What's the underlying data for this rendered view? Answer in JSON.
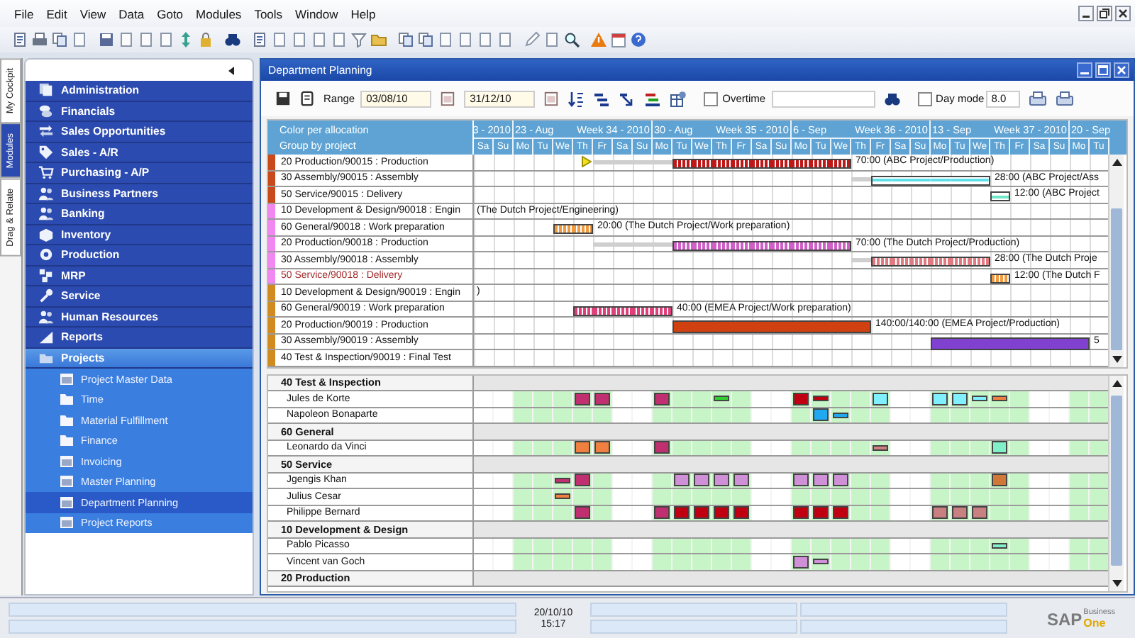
{
  "menu": [
    "File",
    "Edit",
    "View",
    "Data",
    "Goto",
    "Modules",
    "Tools",
    "Window",
    "Help"
  ],
  "side_tabs": [
    {
      "label": "My Cockpit",
      "selected": false
    },
    {
      "label": "Modules",
      "selected": true
    },
    {
      "label": "Drag & Relate",
      "selected": false
    }
  ],
  "modules": [
    {
      "label": "Administration",
      "expanded": false
    },
    {
      "label": "Financials",
      "expanded": false
    },
    {
      "label": "Sales Opportunities",
      "expanded": false
    },
    {
      "label": "Sales - A/R",
      "expanded": false
    },
    {
      "label": "Purchasing - A/P",
      "expanded": false
    },
    {
      "label": "Business Partners",
      "expanded": false
    },
    {
      "label": "Banking",
      "expanded": false
    },
    {
      "label": "Inventory",
      "expanded": false
    },
    {
      "label": "Production",
      "expanded": false
    },
    {
      "label": "MRP",
      "expanded": false
    },
    {
      "label": "Service",
      "expanded": false
    },
    {
      "label": "Human Resources",
      "expanded": false
    },
    {
      "label": "Reports",
      "expanded": false
    },
    {
      "label": "Projects",
      "expanded": true,
      "children": [
        {
          "label": "Project Master Data",
          "kind": "form",
          "selected": false
        },
        {
          "label": "Time",
          "kind": "folder",
          "selected": false
        },
        {
          "label": "Material Fulfillment",
          "kind": "folder",
          "selected": false
        },
        {
          "label": "Finance",
          "kind": "folder",
          "selected": false
        },
        {
          "label": "Invoicing",
          "kind": "form",
          "selected": false
        },
        {
          "label": "Master Planning",
          "kind": "form",
          "selected": false
        },
        {
          "label": "Department Planning",
          "kind": "form",
          "selected": true
        },
        {
          "label": "Project Reports",
          "kind": "form",
          "selected": false
        }
      ]
    }
  ],
  "planning": {
    "title": "Department Planning",
    "range_label": "Range",
    "range_from": "03/08/10",
    "range_to": "31/12/10",
    "overtime": {
      "label": "Overtime",
      "checked": false
    },
    "day_mode": {
      "label": "Day mode",
      "checked": false,
      "value": "8.0"
    },
    "header_labels": [
      "Color per allocation",
      "Group by project"
    ],
    "timeline": {
      "weeks": [
        {
          "week": "3 - 2010",
          "days": [
            {
              "label": "Sa",
              "weekend": true
            },
            {
              "label": "Su",
              "weekend": true
            }
          ]
        },
        {
          "date": "23 - Aug",
          "week": "Week 34 - 2010",
          "days": [
            {
              "label": "Mo",
              "weekend": false
            },
            {
              "label": "Tu",
              "weekend": false
            },
            {
              "label": "We",
              "weekend": false
            },
            {
              "label": "Th",
              "weekend": false
            },
            {
              "label": "Fr",
              "weekend": false
            },
            {
              "label": "Sa",
              "weekend": true
            },
            {
              "label": "Su",
              "weekend": true
            }
          ]
        },
        {
          "date": "30 - Aug",
          "week": "Week 35 - 2010",
          "days": [
            {
              "label": "Mo",
              "weekend": false
            },
            {
              "label": "Tu",
              "weekend": false
            },
            {
              "label": "We",
              "weekend": false
            },
            {
              "label": "Th",
              "weekend": false
            },
            {
              "label": "Fr",
              "weekend": false
            },
            {
              "label": "Sa",
              "weekend": true
            },
            {
              "label": "Su",
              "weekend": true
            }
          ]
        },
        {
          "date": "6 - Sep",
          "week": "Week 36 - 2010",
          "days": [
            {
              "label": "Mo",
              "weekend": false
            },
            {
              "label": "Tu",
              "weekend": false
            },
            {
              "label": "We",
              "weekend": false
            },
            {
              "label": "Th",
              "weekend": false
            },
            {
              "label": "Fr",
              "weekend": false
            },
            {
              "label": "Sa",
              "weekend": true
            },
            {
              "label": "Su",
              "weekend": true
            }
          ]
        },
        {
          "date": "13 - Sep",
          "week": "Week 37 - 2010",
          "days": [
            {
              "label": "Mo",
              "weekend": false
            },
            {
              "label": "Tu",
              "weekend": false
            },
            {
              "label": "We",
              "weekend": false
            },
            {
              "label": "Th",
              "weekend": false
            },
            {
              "label": "Fr",
              "weekend": false
            },
            {
              "label": "Sa",
              "weekend": true
            },
            {
              "label": "Su",
              "weekend": true
            }
          ]
        },
        {
          "date": "20 - Sep",
          "days": [
            {
              "label": "Mo",
              "weekend": false
            },
            {
              "label": "Tu",
              "weekend": false
            }
          ]
        }
      ]
    },
    "rows": [
      {
        "label": "20 Production/90015 : Production",
        "color": "#c84a1a",
        "highlighted": false,
        "text": "70:00 (ABC Project/Production)",
        "cells": [
          null,
          null,
          null,
          null,
          null,
          {
            "kind": "milestone"
          },
          {
            "kind": "lead"
          },
          {
            "kind": "lead"
          },
          {
            "kind": "lead"
          },
          {
            "kind": "lead"
          },
          {
            "kind": "hatched",
            "color": "#c01818"
          },
          {
            "kind": "hatched",
            "color": "#c01818"
          },
          {
            "kind": "hatched",
            "color": "#c01818"
          },
          {
            "kind": "hatched",
            "color": "#c01818"
          },
          {
            "kind": "hatched",
            "color": "#c01818"
          },
          {
            "kind": "hatched",
            "color": "#c01818"
          },
          {
            "kind": "hatched",
            "color": "#c01818"
          },
          {
            "kind": "hatched",
            "color": "#c01818"
          },
          {
            "kind": "hatched",
            "color": "#c01818"
          }
        ]
      },
      {
        "label": "30 Assembly/90015 : Assembly",
        "color": "#c84a1a",
        "highlighted": false,
        "text": "28:00 (ABC Project/Ass",
        "cells": [
          null,
          null,
          null,
          null,
          null,
          null,
          null,
          null,
          null,
          null,
          null,
          null,
          null,
          null,
          null,
          null,
          null,
          null,
          null,
          {
            "kind": "lead"
          },
          {
            "kind": "outline",
            "color": "#60e0e8"
          },
          {
            "kind": "outline",
            "color": "#60e0e8"
          },
          {
            "kind": "outline",
            "color": "#60e0e8"
          },
          {
            "kind": "outline",
            "color": "#60e0e8"
          },
          {
            "kind": "outline",
            "color": "#60e0e8"
          },
          {
            "kind": "outline",
            "color": "#60e0e8"
          }
        ]
      },
      {
        "label": "50 Service/90015 : Delivery",
        "color": "#c84a1a",
        "highlighted": false,
        "text": "12:00 (ABC Project",
        "cells": [
          null,
          null,
          null,
          null,
          null,
          null,
          null,
          null,
          null,
          null,
          null,
          null,
          null,
          null,
          null,
          null,
          null,
          null,
          null,
          null,
          null,
          null,
          null,
          null,
          null,
          null,
          {
            "kind": "outline",
            "color": "#70e8c8"
          }
        ]
      },
      {
        "label": "10 Development & Design/90018 : Engin",
        "color": "#f088f0",
        "highlighted": false,
        "text": "(The Dutch Project/Engineering)"
      },
      {
        "label": "60 General/90018 : Work preparation",
        "color": "#f088f0",
        "highlighted": false,
        "text": "20:00 (The Dutch Project/Work preparation)",
        "cells": [
          null,
          null,
          null,
          null,
          {
            "kind": "hatched",
            "color": "#f09a40"
          },
          {
            "kind": "hatched",
            "color": "#f09a40"
          }
        ]
      },
      {
        "label": "20 Production/90018 : Production",
        "color": "#f088f0",
        "highlighted": false,
        "text": "70:00 (The Dutch Project/Production)",
        "cells": [
          null,
          null,
          null,
          null,
          null,
          null,
          {
            "kind": "lead"
          },
          {
            "kind": "lead"
          },
          {
            "kind": "lead"
          },
          {
            "kind": "lead"
          },
          {
            "kind": "hatched",
            "color": "#d060c8"
          },
          {
            "kind": "hatched",
            "color": "#d060c8"
          },
          {
            "kind": "hatched",
            "color": "#d060c8"
          },
          {
            "kind": "hatched",
            "color": "#d060c8"
          },
          {
            "kind": "hatched",
            "color": "#d060c8"
          },
          {
            "kind": "hatched",
            "color": "#d060c8"
          },
          {
            "kind": "hatched",
            "color": "#d060c8"
          },
          {
            "kind": "hatched",
            "color": "#d060c8"
          },
          {
            "kind": "hatched",
            "color": "#d060c8"
          }
        ]
      },
      {
        "label": "30 Assembly/90018 : Assembly",
        "color": "#f088f0",
        "highlighted": false,
        "text": "28:00 (The Dutch Proje",
        "cells": [
          null,
          null,
          null,
          null,
          null,
          null,
          null,
          null,
          null,
          null,
          null,
          null,
          null,
          null,
          null,
          null,
          null,
          null,
          null,
          {
            "kind": "lead"
          },
          {
            "kind": "hatched",
            "color": "#e07a80"
          },
          {
            "kind": "hatched",
            "color": "#e07a80"
          },
          {
            "kind": "hatched",
            "color": "#e07a80"
          },
          {
            "kind": "hatched",
            "color": "#e07a80"
          },
          {
            "kind": "hatched",
            "color": "#e07a80"
          },
          {
            "kind": "hatched",
            "color": "#e07a80"
          }
        ]
      },
      {
        "label": "50 Service/90018 : Delivery",
        "color": "#f088f0",
        "highlighted": true,
        "text": "12:00 (The Dutch F",
        "cells": [
          null,
          null,
          null,
          null,
          null,
          null,
          null,
          null,
          null,
          null,
          null,
          null,
          null,
          null,
          null,
          null,
          null,
          null,
          null,
          null,
          null,
          null,
          null,
          null,
          null,
          null,
          {
            "kind": "hatched",
            "color": "#f09a40"
          }
        ]
      },
      {
        "label": "10 Development & Design/90019 : Engin",
        "color": "#d08a20",
        "highlighted": false,
        "text": ")"
      },
      {
        "label": "60 General/90019 : Work preparation",
        "color": "#d08a20",
        "highlighted": false,
        "text": "40:00 (EMEA Project/Work preparation)",
        "cells": [
          null,
          null,
          null,
          null,
          null,
          {
            "kind": "hatched",
            "color": "#e0407a"
          },
          {
            "kind": "hatched",
            "color": "#e0407a"
          },
          {
            "kind": "hatched",
            "color": "#e0407a"
          },
          {
            "kind": "hatched",
            "color": "#e0407a"
          },
          {
            "kind": "hatched",
            "color": "#e0407a"
          }
        ]
      },
      {
        "label": "20 Production/90019 : Production",
        "color": "#d08a20",
        "highlighted": false,
        "text": "140:00/140:00 (EMEA Project/Production)",
        "cells": [
          null,
          null,
          null,
          null,
          null,
          null,
          null,
          null,
          null,
          null,
          {
            "kind": "solid",
            "color": "#d04010"
          },
          {
            "kind": "solid",
            "color": "#d04010"
          },
          {
            "kind": "solid",
            "color": "#d04010"
          },
          {
            "kind": "solid",
            "color": "#d04010"
          },
          {
            "kind": "solid",
            "color": "#d04010"
          },
          {
            "kind": "solid",
            "color": "#d04010"
          },
          {
            "kind": "solid",
            "color": "#d04010"
          },
          {
            "kind": "solid",
            "color": "#d04010"
          },
          {
            "kind": "solid",
            "color": "#d04010"
          },
          {
            "kind": "solid",
            "color": "#d04010"
          }
        ]
      },
      {
        "label": "30 Assembly/90019 : Assembly",
        "color": "#d08a20",
        "highlighted": false,
        "text": "5",
        "cells": [
          null,
          null,
          null,
          null,
          null,
          null,
          null,
          null,
          null,
          null,
          null,
          null,
          null,
          null,
          null,
          null,
          null,
          null,
          null,
          null,
          null,
          null,
          null,
          {
            "kind": "solid",
            "color": "#8040d0"
          },
          {
            "kind": "solid",
            "color": "#8040d0"
          },
          {
            "kind": "solid",
            "color": "#8040d0"
          },
          {
            "kind": "solid",
            "color": "#8040d0"
          },
          {
            "kind": "solid",
            "color": "#8040d0"
          },
          {
            "kind": "solid",
            "color": "#8040d0"
          },
          {
            "kind": "solid",
            "color": "#8040d0"
          },
          {
            "kind": "solid",
            "color": "#8040d0"
          }
        ]
      },
      {
        "label": "40 Test & Inspection/90019 : Final Test",
        "color": "#d08a20",
        "highlighted": false
      }
    ],
    "resources": [
      {
        "label": "40 Test & Inspection",
        "members": [
          {
            "name": "Jules de Korte",
            "cells": [
              null,
              null,
              null,
              null,
              null,
              {
                "color": "#c03070",
                "kind": "full"
              },
              {
                "color": "#c03070",
                "kind": "full"
              },
              null,
              null,
              {
                "color": "#c03070",
                "kind": "full"
              },
              null,
              null,
              {
                "color": "#30d030",
                "kind": "part"
              },
              null,
              null,
              null,
              {
                "color": "#c00010",
                "kind": "full"
              },
              {
                "color": "#c00010",
                "kind": "part"
              },
              null,
              null,
              {
                "color": "#80f0ff",
                "kind": "full"
              },
              null,
              null,
              {
                "color": "#80f0ff",
                "kind": "full"
              },
              {
                "color": "#80f0ff",
                "kind": "full"
              },
              {
                "color": "#80f0ff",
                "kind": "part"
              },
              {
                "color": "#f08040",
                "kind": "part"
              }
            ]
          },
          {
            "name": "Napoleon Bonaparte",
            "cells": [
              null,
              null,
              null,
              null,
              null,
              null,
              null,
              null,
              null,
              null,
              null,
              null,
              null,
              null,
              null,
              null,
              null,
              {
                "color": "#20a8f0",
                "kind": "full"
              },
              {
                "color": "#20a8f0",
                "kind": "part"
              }
            ]
          }
        ]
      },
      {
        "label": "60 General",
        "members": [
          {
            "name": "Leonardo da Vinci",
            "cells": [
              null,
              null,
              null,
              null,
              null,
              {
                "color": "#f08040",
                "kind": "full"
              },
              {
                "color": "#f08040",
                "kind": "full"
              },
              null,
              null,
              {
                "color": "#c03070",
                "kind": "full"
              },
              null,
              null,
              null,
              null,
              null,
              null,
              null,
              null,
              null,
              null,
              {
                "color": "#d08080",
                "kind": "part"
              },
              null,
              null,
              null,
              null,
              null,
              {
                "color": "#80f0c8",
                "kind": "full"
              }
            ]
          }
        ]
      },
      {
        "label": "50 Service",
        "members": [
          {
            "name": "Jgengis Khan",
            "cells": [
              null,
              null,
              null,
              null,
              {
                "color": "#c03070",
                "kind": "part"
              },
              {
                "color": "#c03070",
                "kind": "full"
              },
              null,
              null,
              null,
              null,
              {
                "color": "#d090d8",
                "kind": "full"
              },
              {
                "color": "#d090d8",
                "kind": "full"
              },
              {
                "color": "#d090d8",
                "kind": "full"
              },
              {
                "color": "#d090d8",
                "kind": "full"
              },
              null,
              null,
              {
                "color": "#d090d8",
                "kind": "full"
              },
              {
                "color": "#d090d8",
                "kind": "full"
              },
              {
                "color": "#d090d8",
                "kind": "full"
              },
              null,
              null,
              null,
              null,
              null,
              null,
              null,
              {
                "color": "#d07838",
                "kind": "full"
              }
            ]
          },
          {
            "name": "Julius Cesar",
            "cells": [
              null,
              null,
              null,
              null,
              {
                "color": "#f08040",
                "kind": "part"
              }
            ]
          },
          {
            "name": "Philippe Bernard",
            "cells": [
              null,
              null,
              null,
              null,
              null,
              {
                "color": "#c03070",
                "kind": "full"
              },
              null,
              null,
              null,
              {
                "color": "#c03070",
                "kind": "full"
              },
              {
                "color": "#c00010",
                "kind": "full"
              },
              {
                "color": "#c00010",
                "kind": "full"
              },
              {
                "color": "#c00010",
                "kind": "full"
              },
              {
                "color": "#c00010",
                "kind": "full"
              },
              null,
              null,
              {
                "color": "#c00010",
                "kind": "full"
              },
              {
                "color": "#c00010",
                "kind": "full"
              },
              {
                "color": "#c00010",
                "kind": "full"
              },
              null,
              null,
              null,
              null,
              {
                "color": "#c88080",
                "kind": "full"
              },
              {
                "color": "#c88080",
                "kind": "full"
              },
              {
                "color": "#c88080",
                "kind": "full"
              }
            ]
          }
        ]
      },
      {
        "label": "10 Development & Design",
        "members": [
          {
            "name": "Pablo Picasso",
            "cells": [
              null,
              null,
              null,
              null,
              null,
              null,
              null,
              null,
              null,
              null,
              null,
              null,
              null,
              null,
              null,
              null,
              null,
              null,
              null,
              null,
              null,
              null,
              null,
              null,
              null,
              null,
              {
                "color": "#80f0c8",
                "kind": "part"
              }
            ]
          },
          {
            "name": "Vincent van Goch",
            "cells": [
              null,
              null,
              null,
              null,
              null,
              null,
              null,
              null,
              null,
              null,
              null,
              null,
              null,
              null,
              null,
              null,
              {
                "color": "#d090d8",
                "kind": "full"
              },
              {
                "color": "#d090d8",
                "kind": "part"
              }
            ]
          }
        ]
      },
      {
        "label": "20 Production"
      }
    ]
  },
  "status_bar": {
    "date": "20/10/10",
    "time": "15:17"
  },
  "logo": {
    "brand": "SAP",
    "line1": "Business",
    "line2": "One"
  }
}
